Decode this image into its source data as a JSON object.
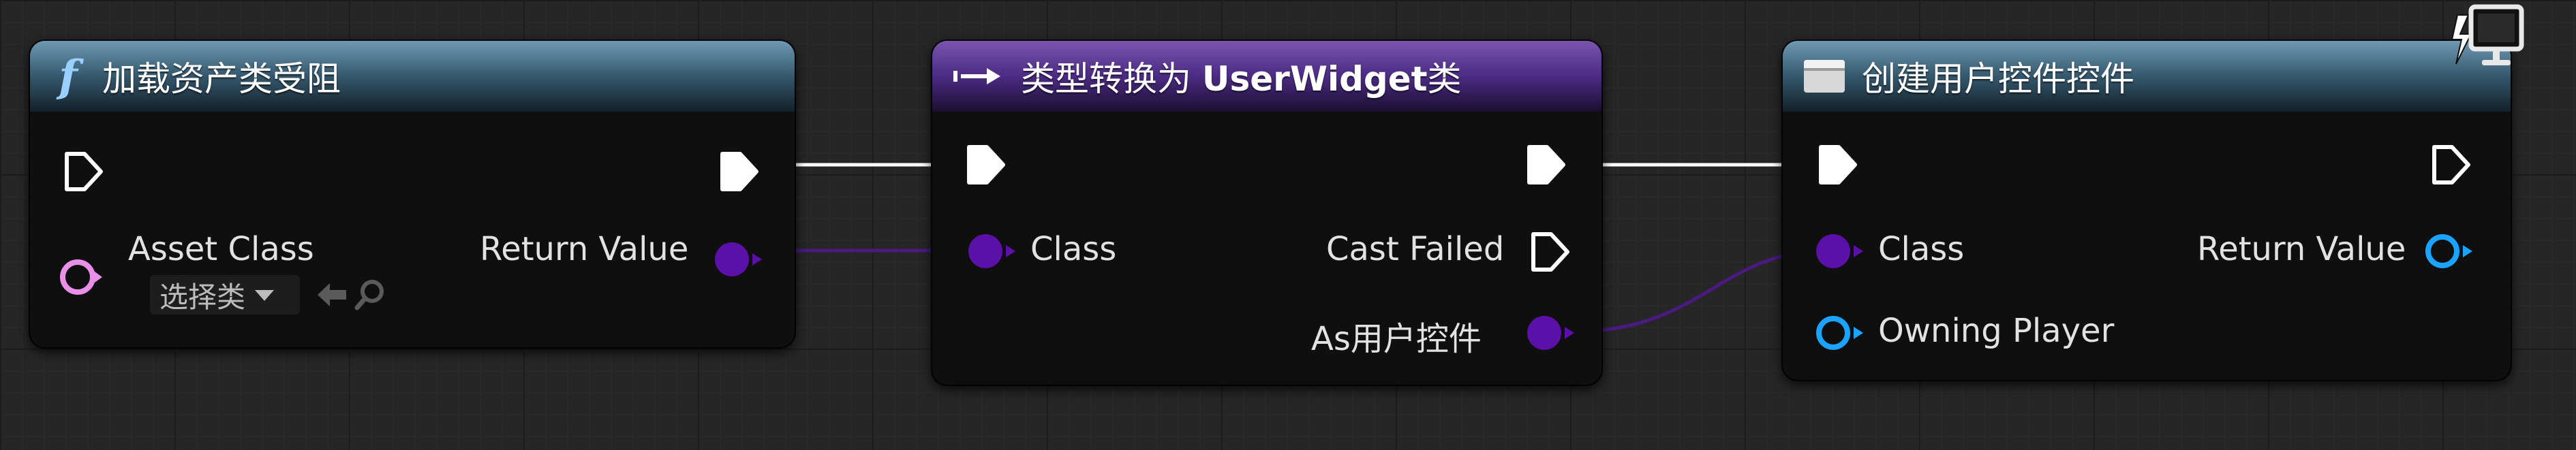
{
  "nodes": {
    "load_asset_class": {
      "title": "加载资产类受阻",
      "header_icon": "function-icon",
      "input_pin_label": "Asset Class",
      "output_pin_label": "Return Value",
      "dropdown_value": "选择类",
      "dropdown_icons": [
        "chevron-down-icon",
        "arrow-left-icon",
        "search-icon"
      ]
    },
    "cast_to_userwidget": {
      "title_prefix": "类型转换为 ",
      "title_bold": "UserWidget",
      "title_suffix": "类",
      "header_icon": "cast-arrow-icon",
      "input_pin_label": "Class",
      "cast_failed_label": "Cast Failed",
      "as_output_label": "As用户控件"
    },
    "create_widget": {
      "title": "创建用户控件控件",
      "header_icon": "widget-icon",
      "class_pin_label": "Class",
      "return_value_label": "Return Value",
      "owning_player_label": "Owning Player",
      "corner_icon": "monitor-lightning-icon"
    }
  },
  "colors": {
    "background": "#262626",
    "node_body": "#0f0f0f",
    "function_header": "#35586d",
    "cast_header": "#4c2b84",
    "exec_pin": "#ffffff",
    "class_pin": "#5b10a8",
    "class_reference_pin": "#e890e8",
    "object_pin": "#1aa3ff",
    "wire_class": "#4a1a80",
    "wire_exec": "#ffffff"
  }
}
